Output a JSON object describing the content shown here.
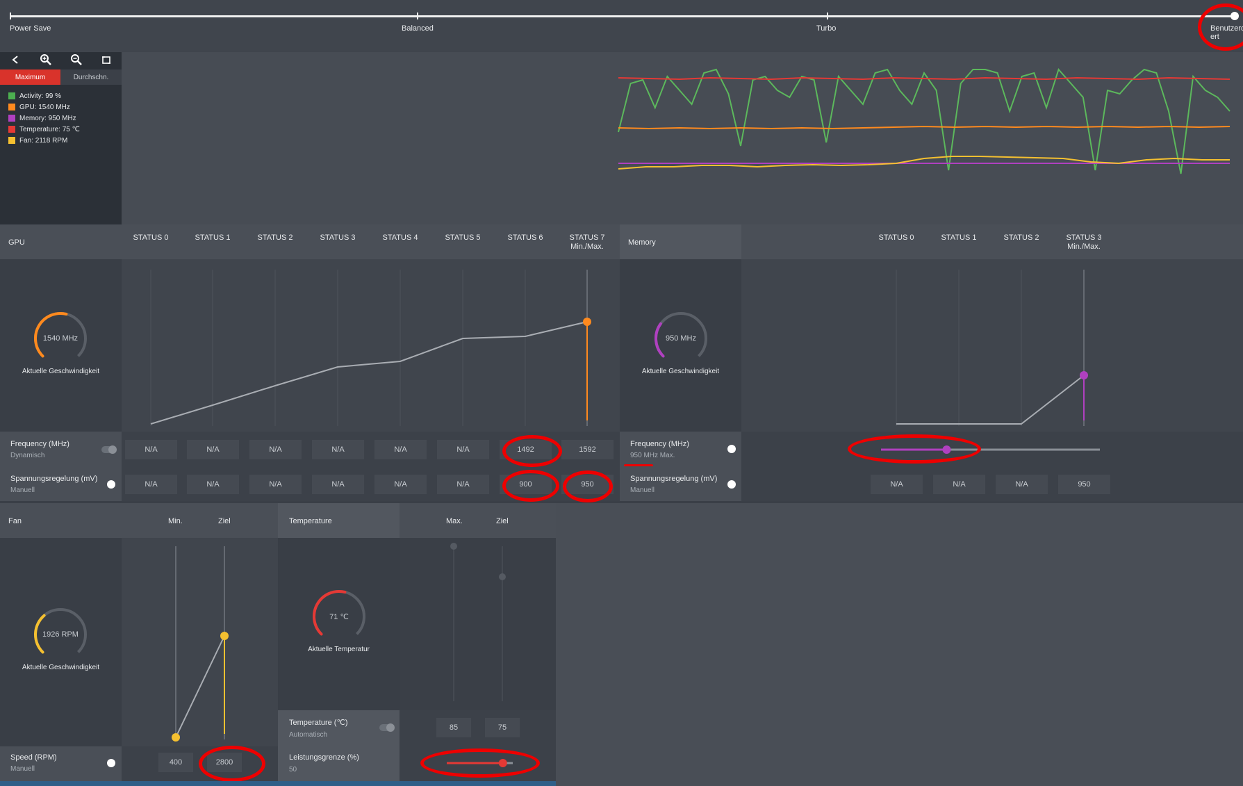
{
  "profile_slider": {
    "stops": [
      "Power Save",
      "Balanced",
      "Turbo",
      "Benutzerdefiniert"
    ],
    "last_stop_text": "Benutzerd\nert",
    "selected_index": 3
  },
  "toolbar": {
    "icons": [
      "chevron-left-icon",
      "zoom-in-icon",
      "zoom-out-icon",
      "reset-zoom-icon"
    ]
  },
  "graph_tabs": {
    "maximum": "Maximum",
    "average": "Durchschn."
  },
  "legend": [
    {
      "label": "Activity: 99 %",
      "color": "#4caf50"
    },
    {
      "label": "GPU: 1540 MHz",
      "color": "#ff8a1e"
    },
    {
      "label": "Memory: 950 MHz",
      "color": "#b040c0"
    },
    {
      "label": "Temperature: 75 ℃",
      "color": "#e53935"
    },
    {
      "label": "Fan: 2118 RPM",
      "color": "#f5c030"
    }
  ],
  "gpu": {
    "title": "GPU",
    "gauge_value": "1540 MHz",
    "gauge_label": "Aktuelle Geschwindigkeit",
    "gauge_fraction": 0.55,
    "states": [
      "STATUS 0",
      "STATUS 1",
      "STATUS 2",
      "STATUS 3",
      "STATUS 4",
      "STATUS 5",
      "STATUS 6",
      "STATUS 7"
    ],
    "state7_sub": "Min./Max.",
    "frequency_label": "Frequency (MHz)",
    "frequency_mode": "Dynamisch",
    "frequency_values": [
      "N/A",
      "N/A",
      "N/A",
      "N/A",
      "N/A",
      "N/A",
      "1492",
      "1592"
    ],
    "voltage_label": "Spannungsregelung (mV)",
    "voltage_mode": "Manuell",
    "voltage_values": [
      "N/A",
      "N/A",
      "N/A",
      "N/A",
      "N/A",
      "N/A",
      "900",
      "950"
    ]
  },
  "memory": {
    "title": "Memory",
    "gauge_value": "950 MHz",
    "gauge_label": "Aktuelle Geschwindigkeit",
    "gauge_fraction": 0.3,
    "states": [
      "STATUS 0",
      "STATUS 1",
      "STATUS 2",
      "STATUS 3"
    ],
    "state3_sub": "Min./Max.",
    "frequency_label": "Frequency (MHz)",
    "frequency_mode": "950 MHz Max.",
    "frequency_slider_fraction": 0.3,
    "voltage_label": "Spannungsregelung (mV)",
    "voltage_mode": "Manuell",
    "voltage_values": [
      "N/A",
      "N/A",
      "N/A",
      "950"
    ]
  },
  "fan": {
    "title": "Fan",
    "col_min": "Min.",
    "col_target": "Ziel",
    "gauge_value": "1926 RPM",
    "gauge_label": "Aktuelle Geschwindigkeit",
    "gauge_fraction": 0.35,
    "speed_label": "Speed (RPM)",
    "speed_mode": "Manuell",
    "min_value": "400",
    "target_value": "2800"
  },
  "temperature": {
    "title": "Temperature",
    "col_max": "Max.",
    "col_target": "Ziel",
    "gauge_value": "71 ℃",
    "gauge_label": "Aktuelle Temperatur",
    "gauge_fraction": 0.55,
    "temp_label": "Temperature (℃)",
    "temp_mode": "Automatisch",
    "max_value": "85",
    "target_value": "75",
    "power_label": "Leistungsgrenze (%)",
    "power_value": "50",
    "power_slider_fraction": 0.85
  },
  "colors": {
    "accent_red": "#e53935",
    "gpu_orange": "#ff8a1e",
    "memory_purple": "#b040c0",
    "fan_yellow": "#f5c030",
    "activity_green": "#4caf50"
  }
}
